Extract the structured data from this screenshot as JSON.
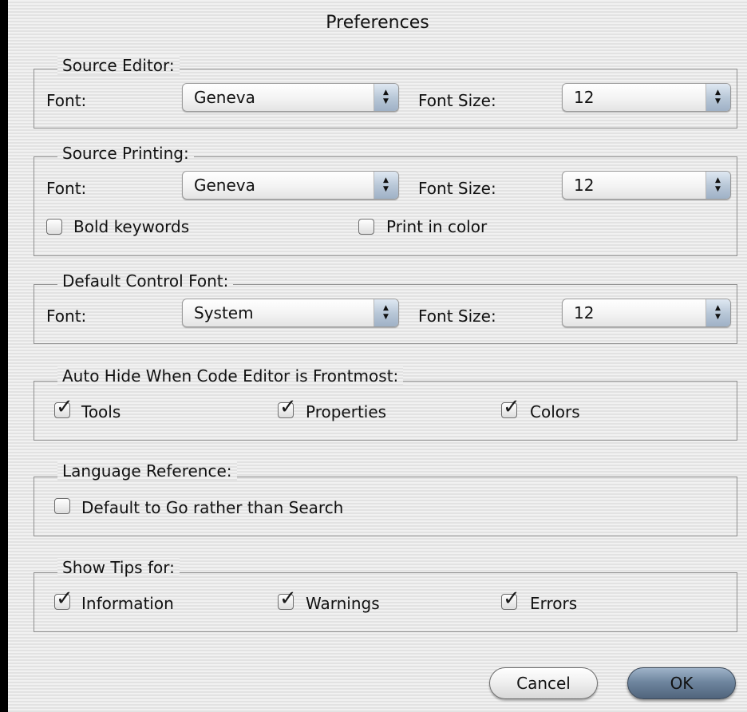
{
  "window": {
    "title": "Preferences"
  },
  "source_editor": {
    "legend": "Source Editor:",
    "font_label": "Font:",
    "font_value": "Geneva",
    "size_label": "Font Size:",
    "size_value": "12"
  },
  "source_printing": {
    "legend": "Source Printing:",
    "font_label": "Font:",
    "font_value": "Geneva",
    "size_label": "Font Size:",
    "size_value": "12",
    "bold_keywords": {
      "label": "Bold keywords",
      "checked": false
    },
    "print_in_color": {
      "label": "Print in color",
      "checked": false
    }
  },
  "default_control_font": {
    "legend": "Default Control Font:",
    "font_label": "Font:",
    "font_value": "System",
    "size_label": "Font Size:",
    "size_value": "12"
  },
  "auto_hide": {
    "legend": "Auto Hide When Code Editor is Frontmost:",
    "tools": {
      "label": "Tools",
      "checked": true
    },
    "properties": {
      "label": "Properties",
      "checked": true
    },
    "colors": {
      "label": "Colors",
      "checked": true
    }
  },
  "language_reference": {
    "legend": "Language Reference:",
    "default_to_go": {
      "label": "Default to Go rather than Search",
      "checked": false
    }
  },
  "show_tips": {
    "legend": "Show Tips for:",
    "information": {
      "label": "Information",
      "checked": true
    },
    "warnings": {
      "label": "Warnings",
      "checked": true
    },
    "errors": {
      "label": "Errors",
      "checked": true
    }
  },
  "buttons": {
    "cancel": "Cancel",
    "ok": "OK"
  },
  "icons": {
    "checkmark": "checkmark-icon",
    "popup_arrows": "updown-arrows-icon"
  },
  "colors": {
    "ok_button": "#6f869f",
    "popup_arrows": "#b9c8d8"
  }
}
